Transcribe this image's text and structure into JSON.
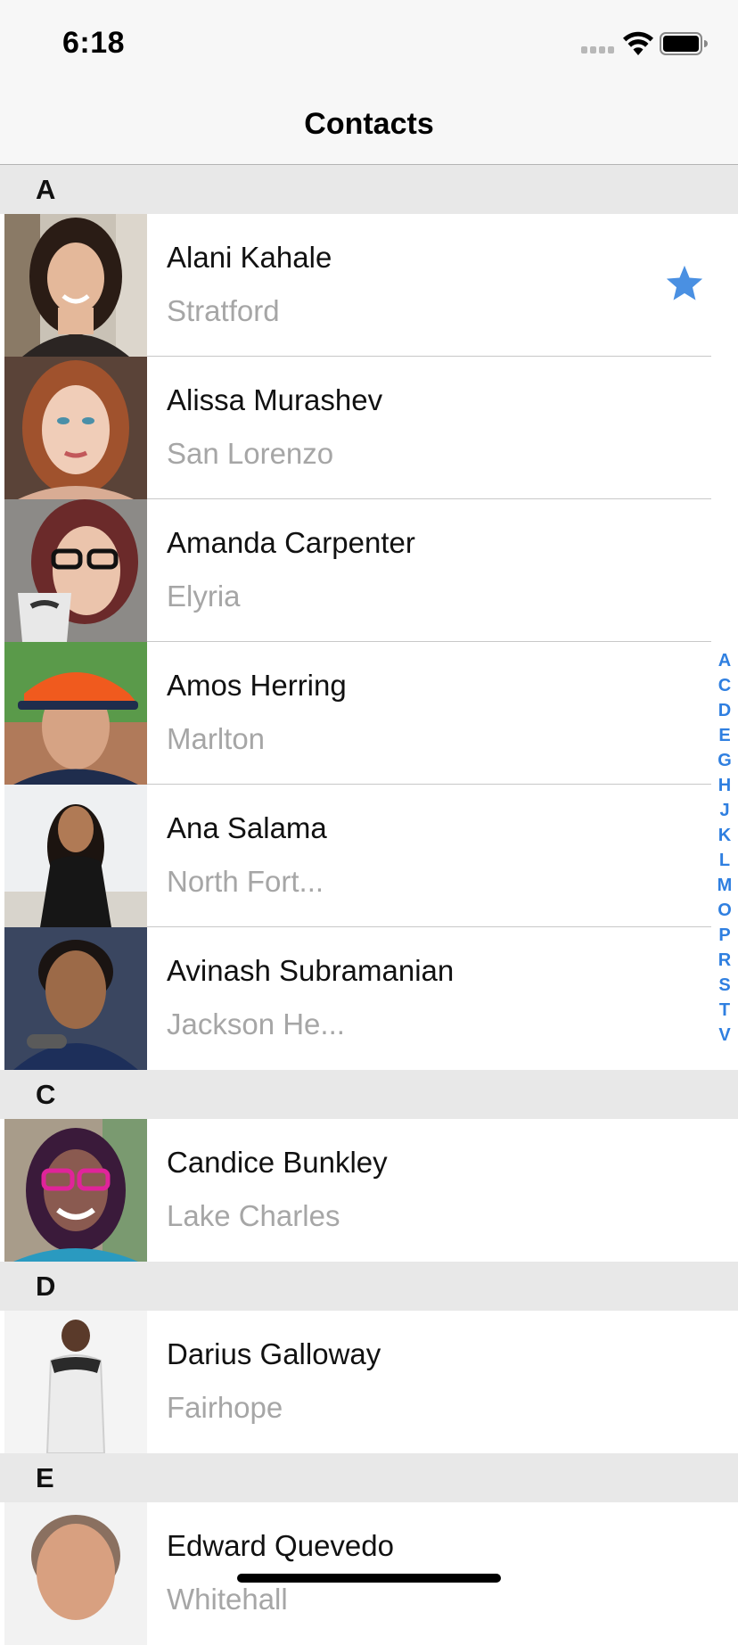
{
  "status_bar": {
    "time": "6:18",
    "icons": [
      "signal-icon",
      "wifi-icon",
      "battery-icon"
    ]
  },
  "nav": {
    "title": "Contacts"
  },
  "sections": [
    {
      "letter": "A",
      "contacts": [
        {
          "name": "Alani Kahale",
          "city": "Stratford",
          "favorite": true
        },
        {
          "name": "Alissa Murashev",
          "city": "San Lorenzo",
          "favorite": false
        },
        {
          "name": "Amanda Carpenter",
          "city": "Elyria",
          "favorite": false
        },
        {
          "name": "Amos Herring",
          "city": "Marlton",
          "favorite": false
        },
        {
          "name": "Ana Salama",
          "city": "North Fort...",
          "favorite": false
        },
        {
          "name": "Avinash Subramanian",
          "city": "Jackson He...",
          "favorite": false
        }
      ]
    },
    {
      "letter": "C",
      "contacts": [
        {
          "name": "Candice Bunkley",
          "city": "Lake Charles",
          "favorite": false
        }
      ]
    },
    {
      "letter": "D",
      "contacts": [
        {
          "name": "Darius Galloway",
          "city": "Fairhope",
          "favorite": false
        }
      ]
    },
    {
      "letter": "E",
      "contacts": [
        {
          "name": "Edward Quevedo",
          "city": "Whitehall",
          "favorite": false
        }
      ]
    }
  ],
  "index_letters": [
    "A",
    "C",
    "D",
    "E",
    "G",
    "H",
    "J",
    "K",
    "L",
    "M",
    "O",
    "P",
    "R",
    "S",
    "T",
    "V"
  ],
  "colors": {
    "accent": "#2f7fe0",
    "star": "#4a90e2",
    "section_bg": "#e8e8e8",
    "secondary_text": "#a6a6a6"
  }
}
